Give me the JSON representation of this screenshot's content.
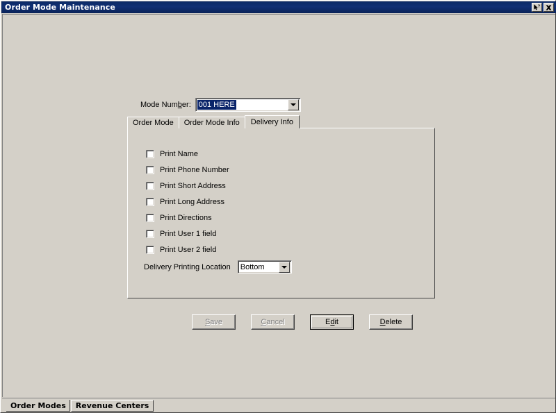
{
  "window": {
    "title": "Order Mode Maintenance",
    "caption_buttons": [
      {
        "name": "context-help-button",
        "glyph": "help-arrow-icon"
      },
      {
        "name": "close-button",
        "glyph": "close-x-icon"
      }
    ]
  },
  "form": {
    "mode_number": {
      "label_before": "Mode Num",
      "label_accel": "b",
      "label_after": "er:",
      "value": "001 HERE",
      "selected": true
    }
  },
  "tabs": {
    "items": [
      {
        "label": "Order Mode",
        "active": false
      },
      {
        "label": "Order Mode Info",
        "active": false
      },
      {
        "label": "Delivery Info",
        "active": true
      }
    ]
  },
  "delivery_info": {
    "checkboxes": [
      {
        "label": "Print Name",
        "checked": false
      },
      {
        "label": "Print Phone Number",
        "checked": false
      },
      {
        "label": "Print Short Address",
        "checked": false
      },
      {
        "label": "Print Long Address",
        "checked": false
      },
      {
        "label": "Print Directions",
        "checked": false
      },
      {
        "label": "Print User 1 field",
        "checked": false
      },
      {
        "label": "Print User 2 field",
        "checked": false
      }
    ],
    "printing_location": {
      "label": "Delivery Printing Location",
      "value": "Bottom"
    }
  },
  "buttons": [
    {
      "name": "save-button",
      "before": "",
      "accel": "S",
      "after": "ave",
      "disabled": true,
      "default": false
    },
    {
      "name": "cancel-button",
      "before": "",
      "accel": "C",
      "after": "ancel",
      "disabled": true,
      "default": false
    },
    {
      "name": "edit-button",
      "before": "E",
      "accel": "d",
      "after": "it",
      "disabled": false,
      "default": true
    },
    {
      "name": "delete-button",
      "before": "",
      "accel": "D",
      "after": "elete",
      "disabled": false,
      "default": false
    }
  ],
  "bottom_tabs": [
    {
      "label": "Order Modes",
      "selected": true
    },
    {
      "label": "Revenue Centers",
      "selected": false
    }
  ],
  "colors": {
    "face": "#d4d0c8",
    "title_bar": "#0b2a66",
    "selection": "#0a246a",
    "text": "#000000",
    "disabled_text": "#808080"
  }
}
